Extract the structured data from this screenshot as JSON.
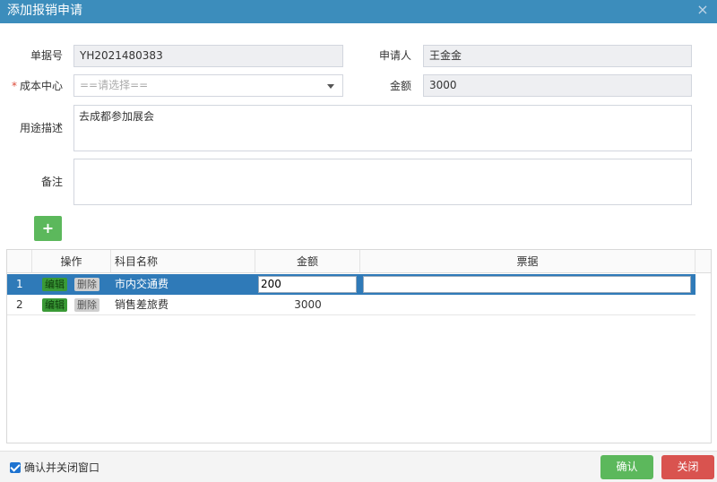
{
  "window": {
    "title": "添加报销申请",
    "close_glyph": "×"
  },
  "form": {
    "doc_no_label": "单据号",
    "doc_no_value": "YH2021480383",
    "applicant_label": "申请人",
    "applicant_value": "王金金",
    "required_mark": "*",
    "cost_center_label": "成本中心",
    "cost_center_placeholder": "==请选择==",
    "amount_label": "金额",
    "amount_value": "3000",
    "purpose_label": "用途描述",
    "purpose_value": "去成都参加展会",
    "remark_label": "备注",
    "remark_value": ""
  },
  "add_button": {
    "glyph": "+"
  },
  "grid": {
    "columns": [
      "操作",
      "科目名称",
      "金额",
      "票据"
    ],
    "edit_label": "编辑",
    "delete_label": "删除",
    "rows": [
      {
        "index": "1",
        "subject": "市内交通费",
        "amount": "200",
        "receipt": "",
        "selected": true
      },
      {
        "index": "2",
        "subject": "销售差旅费",
        "amount": "3000",
        "receipt": "",
        "selected": false
      }
    ]
  },
  "footer": {
    "checkbox_label": "确认并关闭窗口",
    "checked": true,
    "confirm_label": "确认",
    "close_label": "关闭"
  },
  "colors": {
    "titlebar": "#3c8dbc",
    "selected_row": "#2f7ab8",
    "confirm": "#5cb85c",
    "close": "#d9534f"
  }
}
